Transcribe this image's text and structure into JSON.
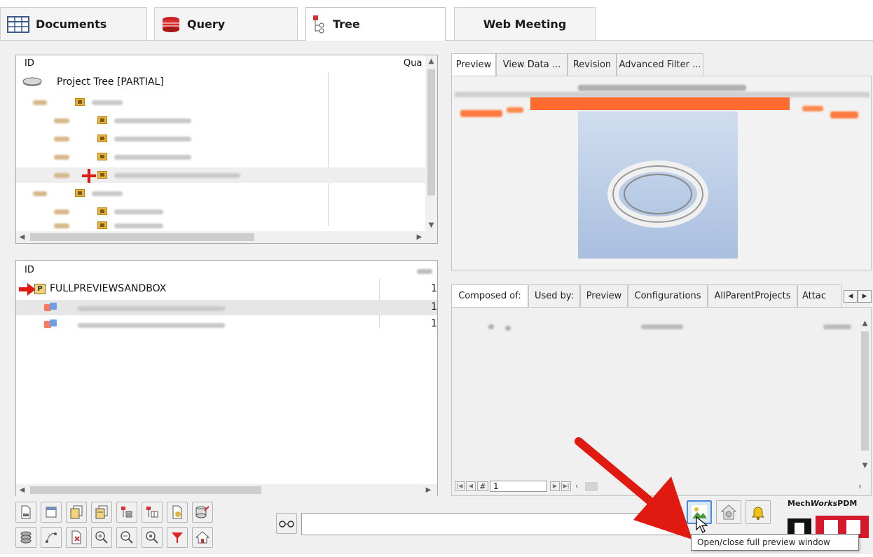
{
  "top_tabs": [
    {
      "label": "Documents",
      "icon": "table-icon"
    },
    {
      "label": "Query",
      "icon": "database-icon"
    },
    {
      "label": "Tree",
      "icon": "tree-icon"
    },
    {
      "label": "Web Meeting",
      "icon": ""
    }
  ],
  "tree_panel": {
    "col_id": "ID",
    "col_qty": "Qua",
    "root_label": "Project Tree [PARTIAL]"
  },
  "preview_panel": {
    "tabs": [
      "Preview",
      "View Data ...",
      "Revision",
      "Advanced Filter ..."
    ]
  },
  "bom_panel": {
    "col_id": "ID",
    "root_label": "FULLPREVIEWSANDBOX",
    "quantities": [
      "1",
      "1",
      "1"
    ]
  },
  "composed_panel": {
    "tabs": [
      "Composed of:",
      "Used by:",
      "Preview",
      "Configurations",
      "AllParentProjects",
      "Attac"
    ],
    "page_input": "1",
    "pager_hash": "#"
  },
  "brand": {
    "text_plain": "MechWorksPDM",
    "text_1": "Mech",
    "text_2": "Works",
    "text_3": "PDM"
  },
  "tooltip": "Open/close full preview window",
  "colors": {
    "accent_orange": "#ff6a2e",
    "arrow_red": "#e01a10",
    "brand_red": "#d4192a"
  }
}
